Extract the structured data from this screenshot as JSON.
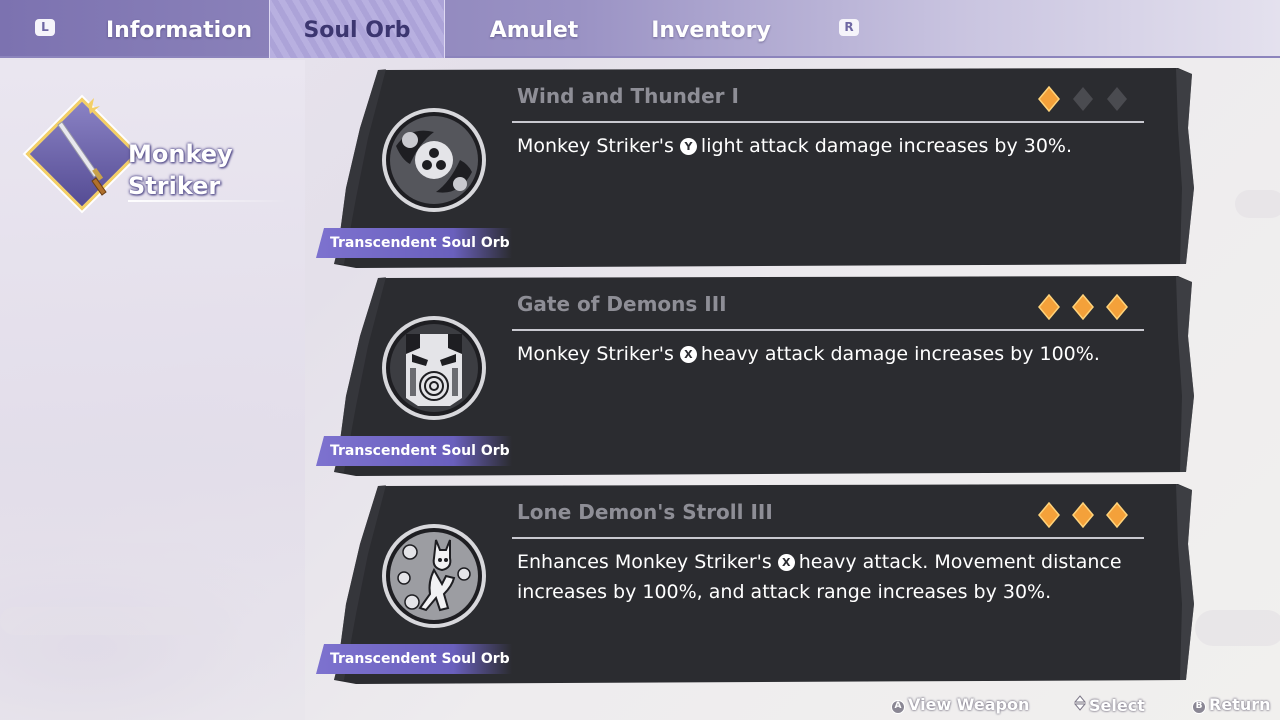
{
  "topbar": {
    "left_button": "L",
    "right_button": "R",
    "tabs": [
      {
        "label": "Information",
        "active": false
      },
      {
        "label": "Soul Orb",
        "active": true
      },
      {
        "label": "Amulet",
        "active": false
      },
      {
        "label": "Inventory",
        "active": false
      }
    ]
  },
  "weapon": {
    "name_line1": "Monkey",
    "name_line2": "Striker",
    "icon": "katana-icon"
  },
  "orbs": [
    {
      "title": "Wind and Thunder I",
      "desc_before": "Monkey Striker's",
      "button": "Y",
      "desc_after": "light attack damage increases by 30%.",
      "tag": "Transcendent Soul Orb",
      "rarity": 1,
      "rarity_max": 3,
      "icon": "tomoe-orb-icon"
    },
    {
      "title": "Gate of Demons III",
      "desc_before": "Monkey Striker's",
      "button": "X",
      "desc_after": "heavy attack damage increases by 100%.",
      "tag": "Transcendent Soul Orb",
      "rarity": 3,
      "rarity_max": 3,
      "icon": "demon-gate-orb-icon"
    },
    {
      "title": "Lone Demon's Stroll III",
      "desc_before": "Enhances Monkey Striker's",
      "button": "X",
      "desc_after": "heavy attack. Movement distance increases by 100%, and attack range increases by 30%.",
      "tag": "Transcendent Soul Orb",
      "rarity": 3,
      "rarity_max": 3,
      "icon": "lone-demon-orb-icon"
    }
  ],
  "footer": {
    "view_weapon": {
      "button": "A",
      "label": "View Weapon"
    },
    "select": {
      "label": "Select"
    },
    "return": {
      "button": "B",
      "label": "Return"
    }
  },
  "colors": {
    "accent": "#7d72cf",
    "card_bg": "#2b2c30",
    "rarity_filled": "#f4a13a",
    "rarity_empty": "#4a4b50"
  }
}
